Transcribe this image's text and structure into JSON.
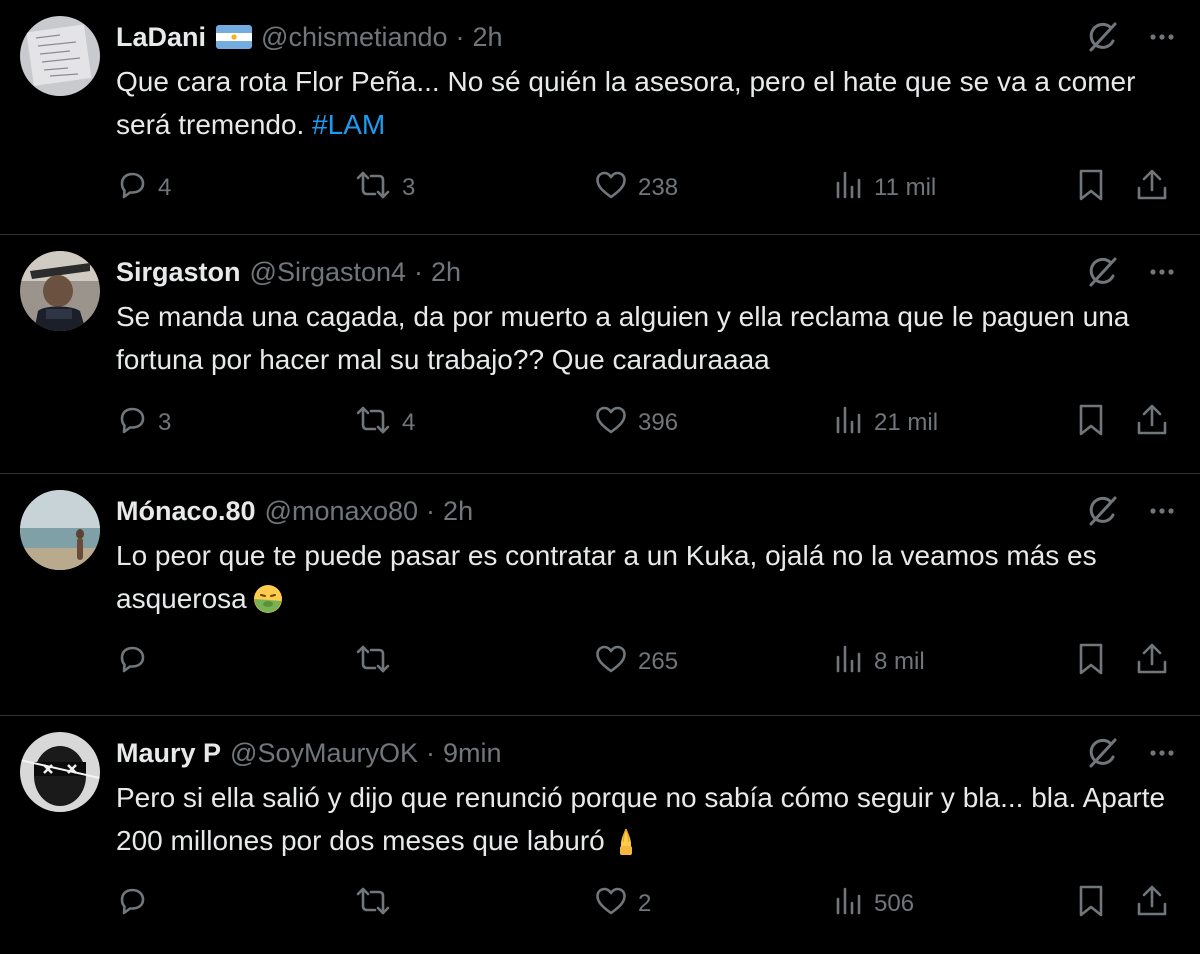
{
  "colors": {
    "background": "#000000",
    "text": "#e7e9ea",
    "secondary": "#71767b",
    "link": "#1d9bf0",
    "divider": "#2f3336"
  },
  "tweets": [
    {
      "name": "LaDani",
      "has_flag": true,
      "flag": "argentina-flag",
      "handle": "@chismetiando",
      "separator": "·",
      "time": "2h",
      "text_parts": [
        "Que cara rota Flor Peña... No sé quién la asesora, pero el hate que se va a comer será tremendo. "
      ],
      "hashtag": "#LAM",
      "emoji": "",
      "replies": "4",
      "retweets": "3",
      "likes": "238",
      "views": "11 mil"
    },
    {
      "name": "Sirgaston",
      "has_flag": false,
      "handle": "@Sirgaston4",
      "separator": "·",
      "time": "2h",
      "text_parts": [
        "Se manda una cagada, da por muerto a alguien y ella reclama que le paguen una fortuna por hacer mal su trabajo?? Que caraduraaaa"
      ],
      "hashtag": "",
      "emoji": "",
      "replies": "3",
      "retweets": "4",
      "likes": "396",
      "views": "21 mil"
    },
    {
      "name": "Mónaco.80",
      "has_flag": false,
      "handle": "@monaxo80",
      "separator": "·",
      "time": "2h",
      "text_parts": [
        "Lo peor que te puede pasar es contratar a un Kuka, ojalá no la veamos más es asquerosa"
      ],
      "hashtag": "",
      "emoji": "nauseated-face-emoji",
      "replies": "",
      "retweets": "",
      "likes": "265",
      "views": "8 mil"
    },
    {
      "name": "Maury P",
      "has_flag": false,
      "handle": "@SoyMauryOK",
      "separator": "·",
      "time": "9min",
      "text_parts": [
        "Pero si ella salió y dijo que renunció porque no sabía cómo seguir y bla... bla. Aparte 200 millones por dos meses que laburó"
      ],
      "hashtag": "",
      "emoji": "pinched-fingers-emoji",
      "replies": "",
      "retweets": "",
      "likes": "2",
      "views": "506"
    }
  ],
  "icons": {
    "grok": "grok-icon",
    "more": "more-icon",
    "reply": "reply-icon",
    "retweet": "retweet-icon",
    "like": "heart-icon",
    "views": "views-icon",
    "bookmark": "bookmark-icon",
    "share": "share-icon"
  }
}
